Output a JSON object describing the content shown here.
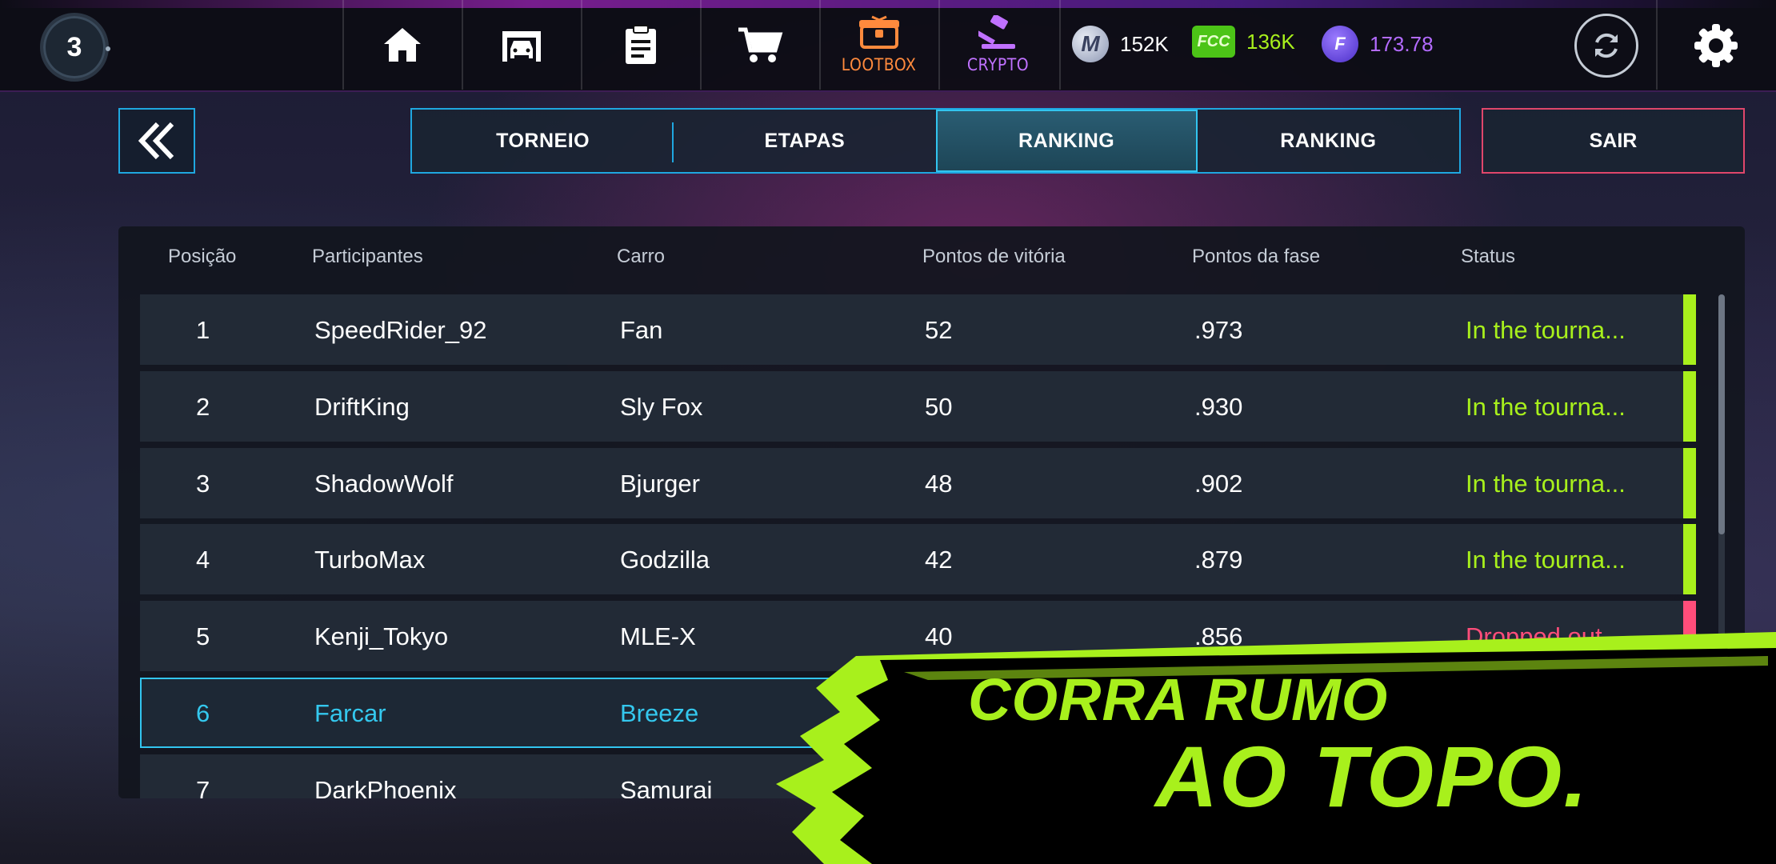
{
  "topbar": {
    "level": "3",
    "nav": [
      {
        "icon": "home-icon",
        "label": ""
      },
      {
        "icon": "garage-icon",
        "label": ""
      },
      {
        "icon": "clipboard-icon",
        "label": ""
      },
      {
        "icon": "cart-icon",
        "label": ""
      },
      {
        "icon": "lootbox-icon",
        "label": "LOOTBOX",
        "color": "#ff8a3d"
      },
      {
        "icon": "crypto-hammer-icon",
        "label": "CRYPTO",
        "color": "#c071ff"
      }
    ],
    "currencies": [
      {
        "icon": "m-coin-icon",
        "symbol": "M",
        "value": "152K",
        "color": "#ffffff"
      },
      {
        "icon": "fcc-coin-icon",
        "symbol": "FCC",
        "value": "136K",
        "color": "#a8f01c"
      },
      {
        "icon": "fv-token-icon",
        "symbol": "F",
        "value": "173.78",
        "color": "#b36bff"
      }
    ]
  },
  "tabs": [
    {
      "label": "TORNEIO",
      "active": false
    },
    {
      "label": "ETAPAS",
      "active": false
    },
    {
      "label": "RANKING",
      "active": true
    },
    {
      "label": "RANKING",
      "active": false
    }
  ],
  "exit_label": "SAIR",
  "table": {
    "headers": [
      "Posição",
      "Participantes",
      "Carro",
      "Pontos de vitória",
      "Pontos da fase",
      "Status"
    ],
    "rows": [
      {
        "pos": "1",
        "name": "SpeedRider_92",
        "car": "Fan",
        "wins": "52",
        "phase": ".973",
        "status": "In the tourna...",
        "status_color": "#a8f01c"
      },
      {
        "pos": "2",
        "name": "DriftKing",
        "car": "Sly Fox",
        "wins": "50",
        "phase": ".930",
        "status": "In the tourna...",
        "status_color": "#a8f01c"
      },
      {
        "pos": "3",
        "name": "ShadowWolf",
        "car": "Bjurger",
        "wins": "48",
        "phase": ".902",
        "status": "In the tourna...",
        "status_color": "#a8f01c"
      },
      {
        "pos": "4",
        "name": "TurboMax",
        "car": "Godzilla",
        "wins": "42",
        "phase": ".879",
        "status": "In the tourna...",
        "status_color": "#a8f01c"
      },
      {
        "pos": "5",
        "name": "Kenji_Tokyo",
        "car": "MLE-X",
        "wins": "40",
        "phase": ".856",
        "status": "Dropped out",
        "status_color": "#ff4d7a"
      },
      {
        "pos": "6",
        "name": "Farcar",
        "car": "Breeze",
        "wins": "",
        "phase": "",
        "status": "",
        "status_color": "#a8f01c"
      },
      {
        "pos": "7",
        "name": "DarkPhoenix",
        "car": "Samurai",
        "wins": "",
        "phase": "",
        "status": "",
        "status_color": "#a8f01c"
      }
    ]
  },
  "promo": {
    "line1": "CORRA RUMO",
    "line2": "AO TOPO."
  },
  "colors": {
    "accent_blue": "#1fa7e0",
    "accent_green": "#a8f01c",
    "danger": "#e0466b"
  }
}
